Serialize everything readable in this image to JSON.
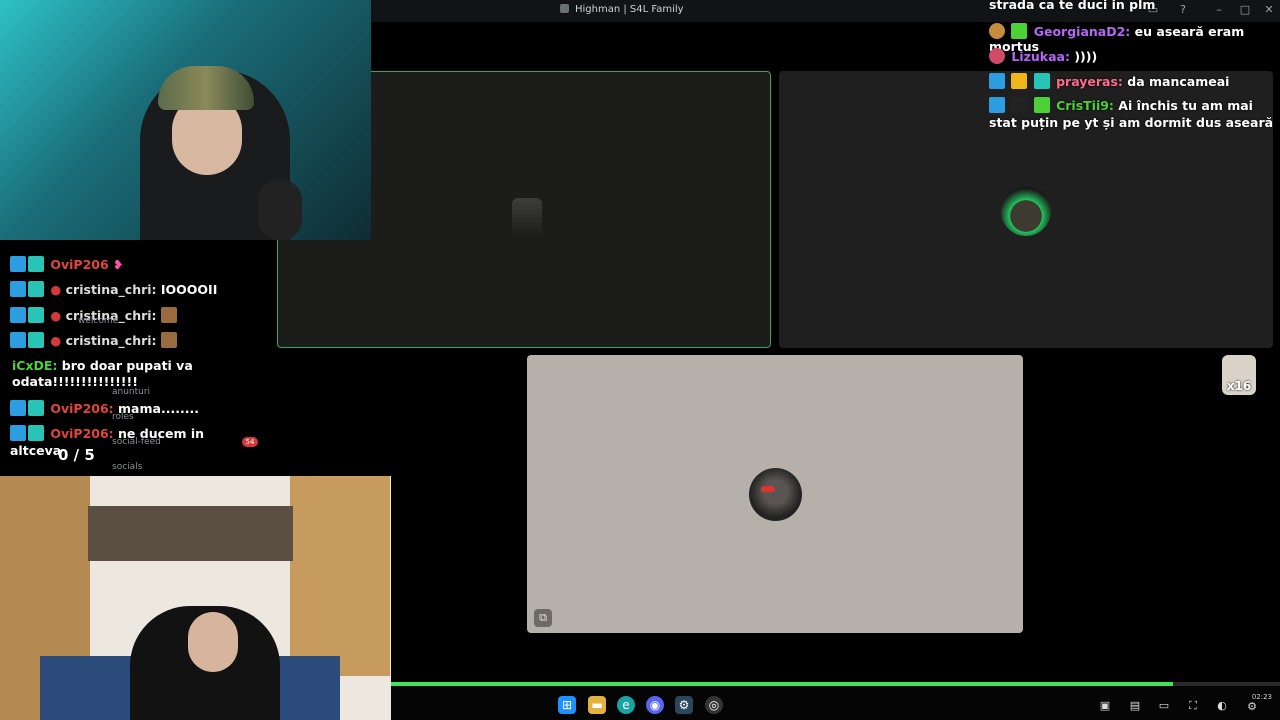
{
  "window": {
    "title": "Highman | S4L Family"
  },
  "left_chat": {
    "messages": [
      {
        "user": "OviP206",
        "text": ""
      },
      {
        "user": "cristina_chri:",
        "text": "IOOOOII"
      },
      {
        "user": "cristina_chri:",
        "text": ""
      },
      {
        "user": "cristina_chri:",
        "text": ""
      },
      {
        "user": "iCxDE",
        "text": "bro doar pupati va odata!!!!!!!!!!!!!!!"
      },
      {
        "user": "OviP206:",
        "text": "mama........"
      },
      {
        "user": "OviP206:",
        "text": "ne ducem in altceva"
      }
    ],
    "faded_channels": [
      "welcome",
      "anunturi",
      "roles",
      "social-feed",
      "socials"
    ],
    "counter": "0  / 5"
  },
  "right_chat": {
    "messages": [
      {
        "user": "",
        "text": "strada ca te duci in plm"
      },
      {
        "user": "GeorgianaD2:",
        "text": "eu aseară eram mortus",
        "color": "#b566f5"
      },
      {
        "user": "Lizukaa:",
        "text": "))))",
        "color": "#b566f5"
      },
      {
        "user": "prayeras:",
        "text": "da mancameai",
        "color": "#ff6b8a"
      },
      {
        "user": "CrisTii9:",
        "text": "Ai închis tu am mai stat puțin pe yt și am dormit dus aseară",
        "color": "#4cd137"
      }
    ]
  },
  "call": {
    "tiles": [
      "participant-1",
      "participant-2",
      "participant-3"
    ],
    "active_speaker_color": "#3aa556",
    "emote_badge": "x16"
  },
  "progress": {
    "fraction": 0.88,
    "color": "#3ee55a"
  },
  "taskbar": {
    "apps": [
      "windows-start-icon",
      "file-explorer-icon",
      "edge-icon",
      "discord-icon",
      "steam-icon",
      "gaming-icon"
    ],
    "clock": "02:23"
  }
}
